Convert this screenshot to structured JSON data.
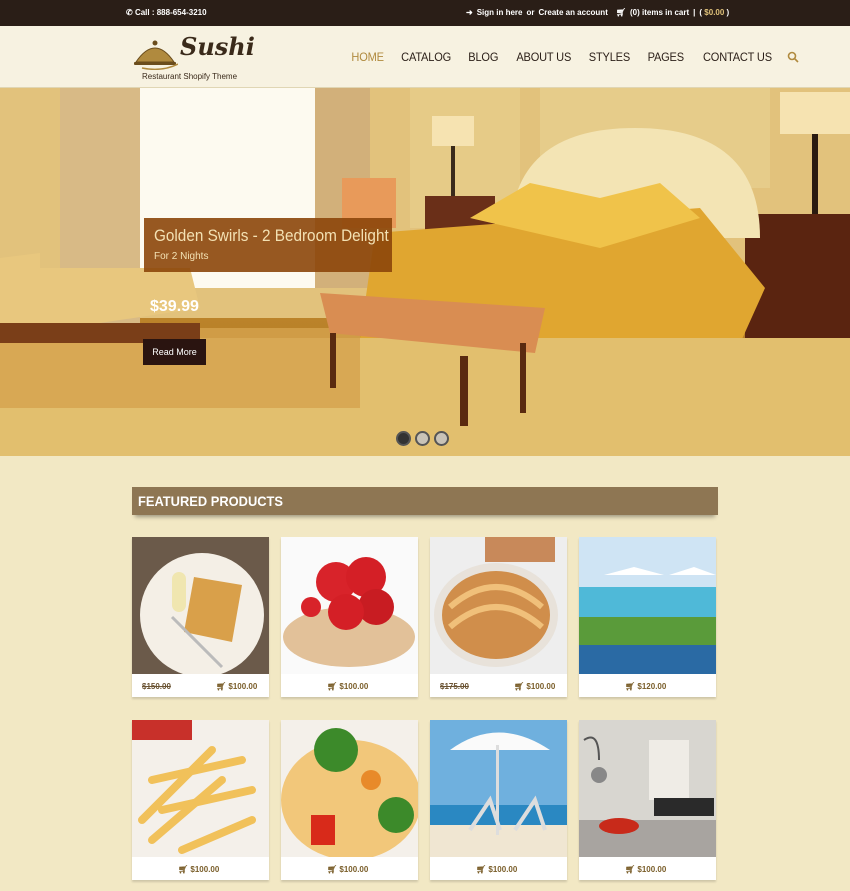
{
  "topbar": {
    "phone": "Call : 888-654-3210",
    "sign_in": "Sign in here",
    "or": "or",
    "create": "Create an account",
    "cart": "(0) items in cart",
    "sep": "|",
    "total": "$0.00"
  },
  "logo": {
    "name": "Sushi",
    "tagline": "Restaurant Shopify Theme"
  },
  "nav": [
    "HOME",
    "CATALOG",
    "BLOG",
    "ABOUT US",
    "STYLES",
    "PAGES",
    "CONTACT US"
  ],
  "hero": {
    "title": "Golden Swirls - 2 Bedroom Delight",
    "subtitle": "For 2 Nights",
    "price": "$39.99",
    "button": "Read More",
    "slides": 3,
    "active_slide": 1
  },
  "featured": {
    "heading": "FEATURED PRODUCTS",
    "products": [
      {
        "old": "$150.00",
        "price": "$100.00",
        "img": "waffles"
      },
      {
        "old": "",
        "price": "$100.00",
        "img": "strawberries"
      },
      {
        "old": "$175.00",
        "price": "$100.00",
        "img": "pie"
      },
      {
        "old": "",
        "price": "$120.00",
        "img": "pool"
      },
      {
        "old": "",
        "price": "$100.00",
        "img": "fries"
      },
      {
        "old": "",
        "price": "$100.00",
        "img": "pasta"
      },
      {
        "old": "",
        "price": "$100.00",
        "img": "beach"
      },
      {
        "old": "",
        "price": "$100.00",
        "img": "room"
      }
    ]
  },
  "colors": {
    "topbar": "#2a1e17",
    "accent": "#b08a3e",
    "bar": "#8e7653",
    "bg": "#f2e8c4"
  }
}
